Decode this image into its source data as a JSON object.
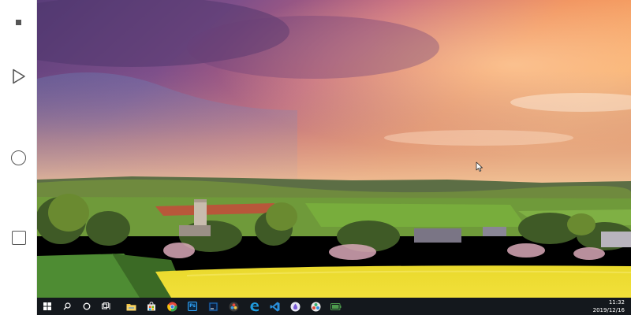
{
  "nav": {
    "items": [
      {
        "name": "menu",
        "icon": "square-dot-icon"
      },
      {
        "name": "back",
        "icon": "triangle-back-icon"
      },
      {
        "name": "home",
        "icon": "circle-home-icon"
      },
      {
        "name": "recent",
        "icon": "square-recents-icon"
      }
    ]
  },
  "wallpaper": {
    "description_icon": "countryside-sunset-wallpaper"
  },
  "taskbar": {
    "buttons": [
      {
        "name": "start",
        "icon": "windows-logo-icon"
      },
      {
        "name": "search",
        "icon": "search-icon"
      },
      {
        "name": "cortana",
        "icon": "cortana-circle-icon"
      },
      {
        "name": "task-view",
        "icon": "task-view-icon"
      }
    ],
    "apps": [
      {
        "name": "file-explorer",
        "icon": "folder-icon",
        "color": "#f2c443",
        "label": ""
      },
      {
        "name": "store",
        "icon": "store-bag-icon",
        "color": "#3a8ee6",
        "label": ""
      },
      {
        "name": "chrome",
        "icon": "chrome-icon",
        "color": "#e64a3c",
        "label": ""
      },
      {
        "name": "photoshop",
        "icon": "photoshop-icon",
        "color": "#0c2a45",
        "label": "Ps"
      },
      {
        "name": "ide",
        "icon": "ide-icon",
        "color": "#1d6fb8",
        "label": ""
      },
      {
        "name": "davinci",
        "icon": "davinci-resolve-icon",
        "color": "#3b3b3b",
        "label": ""
      },
      {
        "name": "edge",
        "icon": "edge-icon",
        "color": "#1f9de0",
        "label": ""
      },
      {
        "name": "vscode",
        "icon": "vscode-icon",
        "color": "#2a8fdb",
        "label": ""
      },
      {
        "name": "app-drop",
        "icon": "drop-circle-icon",
        "color": "#e6e6f2",
        "label": ""
      },
      {
        "name": "app-color",
        "icon": "colorful-circle-icon",
        "color": "#e8e8e8",
        "label": ""
      },
      {
        "name": "app-battery",
        "icon": "battery-icon",
        "color": "#4d9b4d",
        "label": ""
      }
    ],
    "clock": {
      "time": "11:32",
      "date": "2019/12/16"
    }
  }
}
